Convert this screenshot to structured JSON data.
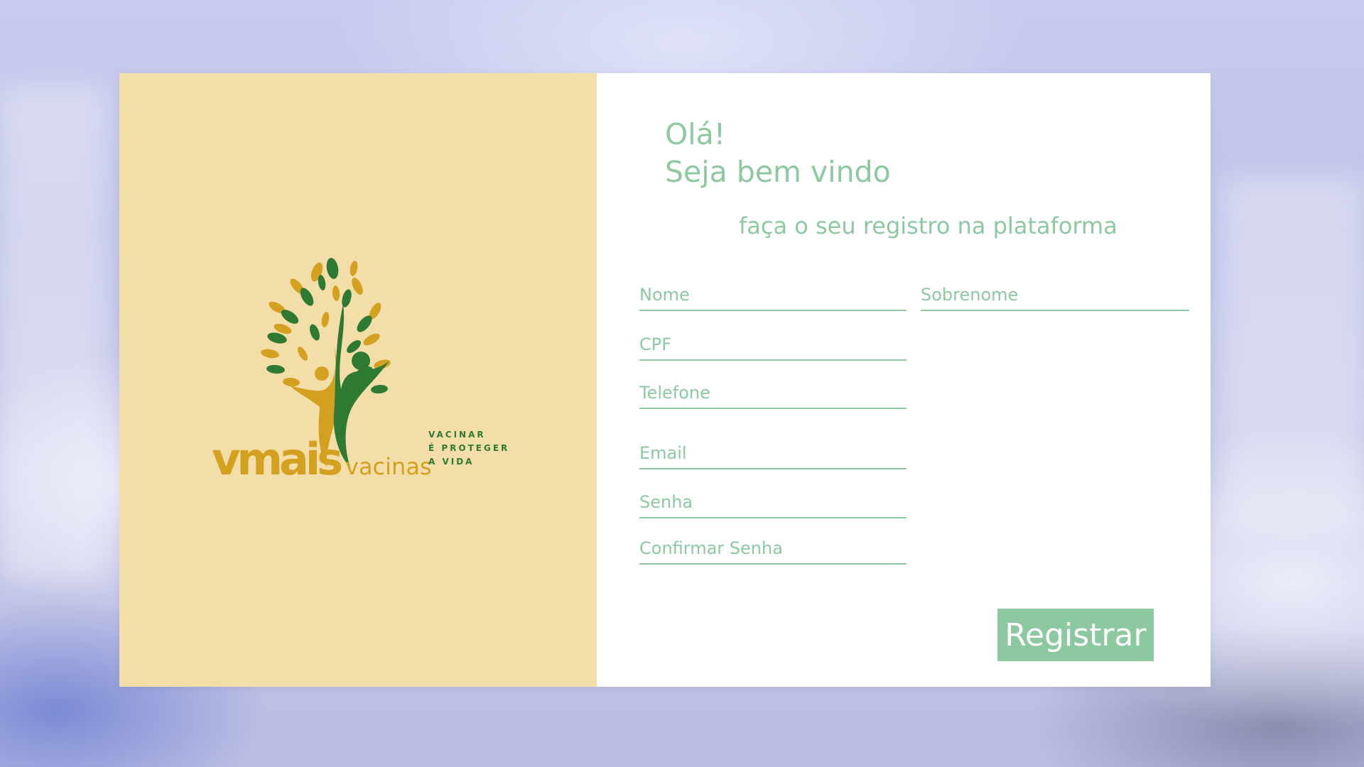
{
  "brand": {
    "name_part1": "vmais",
    "name_part2": "vacinas",
    "tagline": [
      "VACINAR",
      "É PROTEGER",
      "A VIDA"
    ]
  },
  "form": {
    "greeting_line1": "Olá!",
    "greeting_line2": "Seja bem vindo",
    "subtitle": "faça o seu registro na plataforma",
    "fields": {
      "first_name": {
        "placeholder": "Nome",
        "value": ""
      },
      "last_name": {
        "placeholder": "Sobrenome",
        "value": ""
      },
      "cpf": {
        "placeholder": "CPF",
        "value": ""
      },
      "phone": {
        "placeholder": "Telefone",
        "value": ""
      },
      "email": {
        "placeholder": "Email",
        "value": ""
      },
      "password": {
        "placeholder": "Senha",
        "value": ""
      },
      "confirm_password": {
        "placeholder": "Confirmar Senha",
        "value": ""
      }
    },
    "submit_label": "Registrar"
  },
  "colors": {
    "left_panel": "#f3dea9",
    "accent_green": "#8cc9a0",
    "logo_gold": "#d4a020",
    "logo_dark_green": "#2f7a32"
  }
}
